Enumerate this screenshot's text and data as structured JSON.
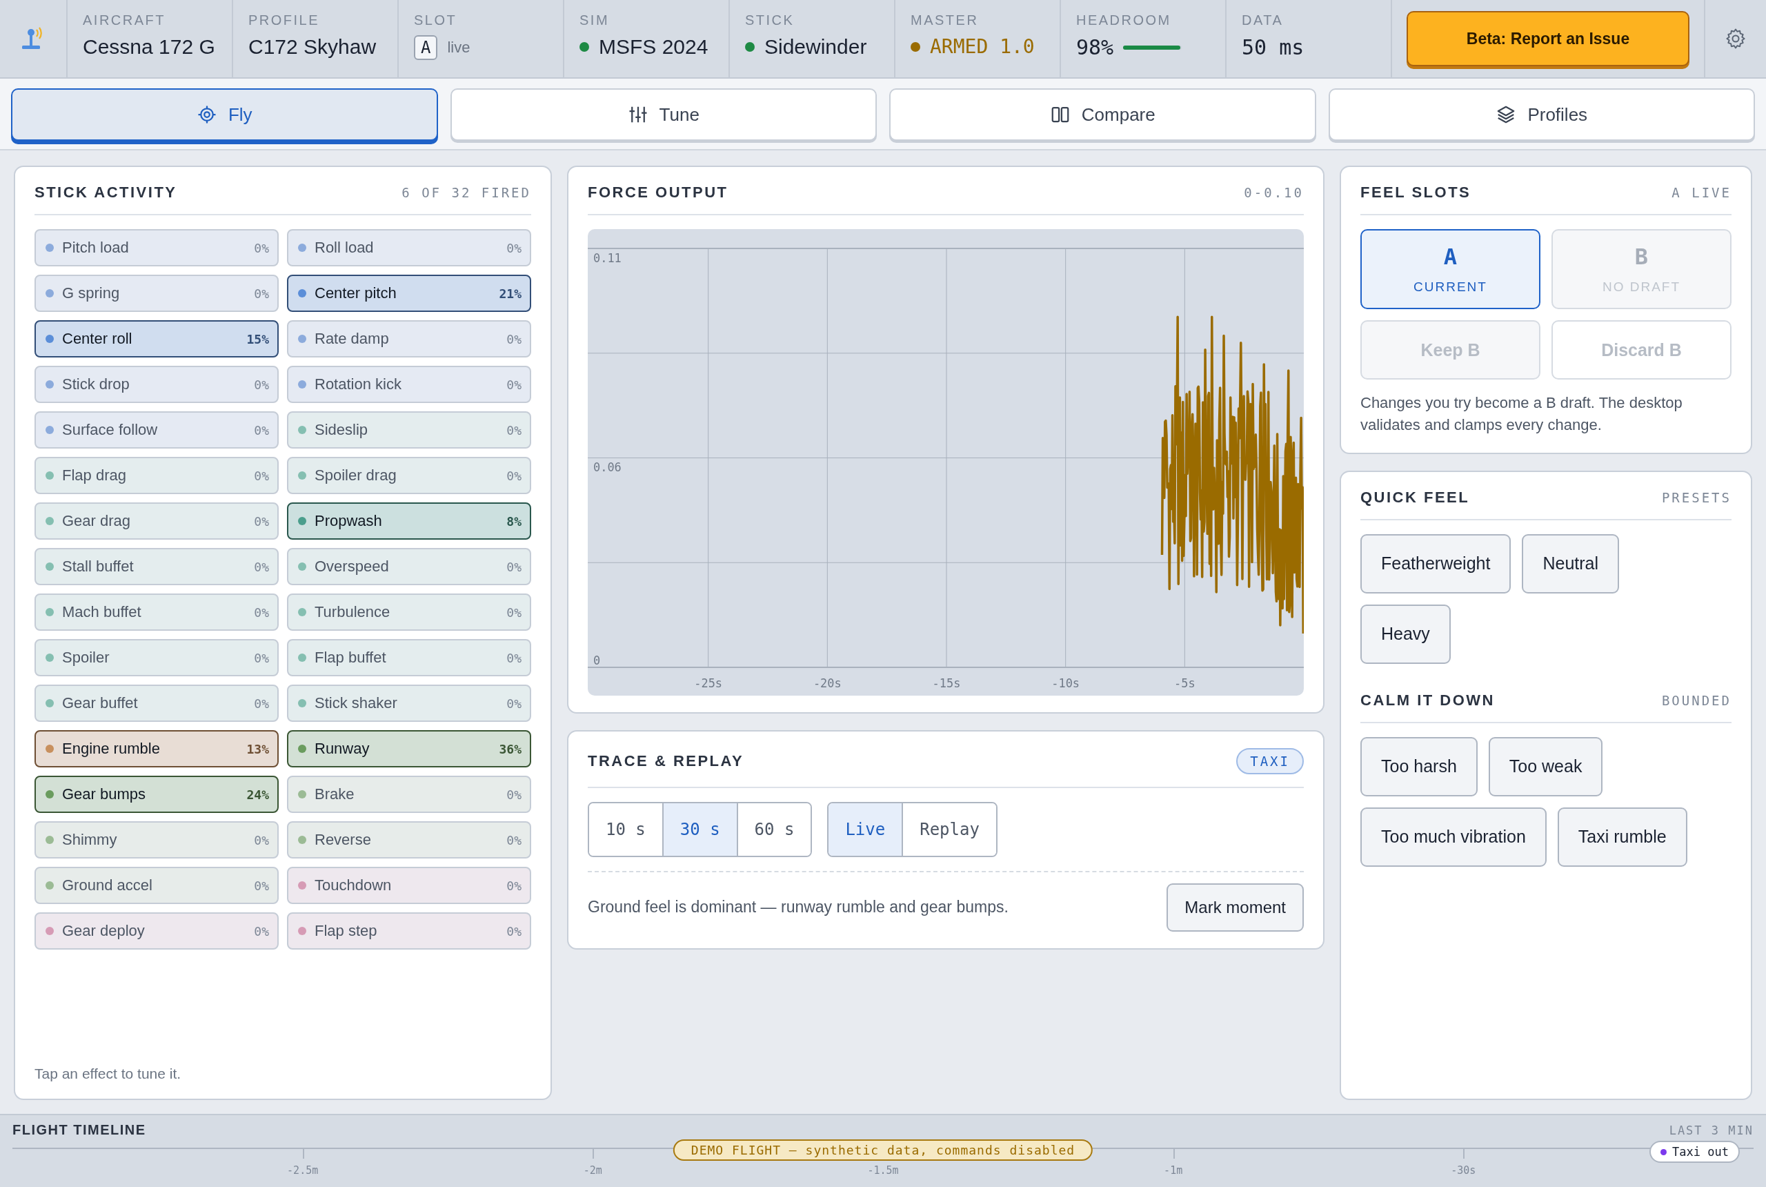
{
  "header": {
    "fields": [
      {
        "kind": "text",
        "label": "AIRCRAFT",
        "value": "Cessna 172 G"
      },
      {
        "kind": "text",
        "label": "PROFILE",
        "value": "C172 Skyhaw"
      },
      {
        "kind": "slot",
        "label": "SLOT",
        "badge": "A",
        "value": "live"
      },
      {
        "kind": "status",
        "label": "SIM",
        "value": "MSFS 2024",
        "color": "#1e8a44"
      },
      {
        "kind": "status",
        "label": "STICK",
        "value": "Sidewinder",
        "color": "#1e8a44"
      },
      {
        "kind": "alert",
        "label": "MASTER",
        "value": "ARMED 1.0",
        "color": "#9a6b00"
      },
      {
        "kind": "meter",
        "label": "HEADROOM",
        "value": "98%",
        "level": 0.98
      },
      {
        "kind": "mono",
        "label": "DATA",
        "value": "50 ms"
      }
    ],
    "report_button": "Beta: Report an Issue"
  },
  "tabs": [
    {
      "label": "Fly",
      "selected": true
    },
    {
      "label": "Tune",
      "selected": false
    },
    {
      "label": "Compare",
      "selected": false
    },
    {
      "label": "Profiles",
      "selected": false
    }
  ],
  "stick_activity": {
    "title": "STICK ACTIVITY",
    "summary": "6 OF 32 FIRED",
    "effects": [
      {
        "label": "Pitch load",
        "value": "0%",
        "color": "#8cabdc",
        "active": false
      },
      {
        "label": "Roll load",
        "value": "0%",
        "color": "#8cabdc",
        "active": false
      },
      {
        "label": "G spring",
        "value": "0%",
        "color": "#8cabdc",
        "active": false
      },
      {
        "label": "Center pitch",
        "value": "21%",
        "color": "#5b8ed8",
        "active": true
      },
      {
        "label": "Center roll",
        "value": "15%",
        "color": "#5b8ed8",
        "active": true
      },
      {
        "label": "Rate damp",
        "value": "0%",
        "color": "#8cabdc",
        "active": false
      },
      {
        "label": "Stick drop",
        "value": "0%",
        "color": "#8cabdc",
        "active": false
      },
      {
        "label": "Rotation kick",
        "value": "0%",
        "color": "#8cabdc",
        "active": false
      },
      {
        "label": "Surface follow",
        "value": "0%",
        "color": "#8cabdc",
        "active": false
      },
      {
        "label": "Sideslip",
        "value": "0%",
        "color": "#85bfb1",
        "active": false
      },
      {
        "label": "Flap drag",
        "value": "0%",
        "color": "#85bfb1",
        "active": false
      },
      {
        "label": "Spoiler drag",
        "value": "0%",
        "color": "#85bfb1",
        "active": false
      },
      {
        "label": "Gear drag",
        "value": "0%",
        "color": "#85bfb1",
        "active": false
      },
      {
        "label": "Propwash",
        "value": "8%",
        "color": "#4a9e8c",
        "active": true
      },
      {
        "label": "Stall buffet",
        "value": "0%",
        "color": "#85bfb1",
        "active": false
      },
      {
        "label": "Overspeed",
        "value": "0%",
        "color": "#85bfb1",
        "active": false
      },
      {
        "label": "Mach buffet",
        "value": "0%",
        "color": "#85bfb1",
        "active": false
      },
      {
        "label": "Turbulence",
        "value": "0%",
        "color": "#85bfb1",
        "active": false
      },
      {
        "label": "Spoiler",
        "value": "0%",
        "color": "#85bfb1",
        "active": false
      },
      {
        "label": "Flap buffet",
        "value": "0%",
        "color": "#85bfb1",
        "active": false
      },
      {
        "label": "Gear buffet",
        "value": "0%",
        "color": "#85bfb1",
        "active": false
      },
      {
        "label": "Stick shaker",
        "value": "0%",
        "color": "#85bfb1",
        "active": false
      },
      {
        "label": "Engine rumble",
        "value": "13%",
        "color": "#c8905e",
        "active": true
      },
      {
        "label": "Runway",
        "value": "36%",
        "color": "#6a9c5e",
        "active": true
      },
      {
        "label": "Gear bumps",
        "value": "24%",
        "color": "#6a9c5e",
        "active": true
      },
      {
        "label": "Brake",
        "value": "0%",
        "color": "#9bbb95",
        "active": false
      },
      {
        "label": "Shimmy",
        "value": "0%",
        "color": "#9bbb95",
        "active": false
      },
      {
        "label": "Reverse",
        "value": "0%",
        "color": "#9bbb95",
        "active": false
      },
      {
        "label": "Ground accel",
        "value": "0%",
        "color": "#9bbb95",
        "active": false
      },
      {
        "label": "Touchdown",
        "value": "0%",
        "color": "#d69bb5",
        "active": false
      },
      {
        "label": "Gear deploy",
        "value": "0%",
        "color": "#d69bb5",
        "active": false
      },
      {
        "label": "Flap step",
        "value": "0%",
        "color": "#d69bb5",
        "active": false
      }
    ],
    "hint": "Tap an effect to tune it."
  },
  "force_output": {
    "title": "FORCE OUTPUT",
    "range": "0-0.10",
    "y_labels": [
      "0.11",
      "0.06",
      "0"
    ],
    "x_labels": [
      "-25s",
      "-20s",
      "-15s",
      "-10s",
      "-5s"
    ]
  },
  "trace_replay": {
    "title": "TRACE & REPLAY",
    "badge": "TAXI",
    "windows": [
      {
        "label": "10 s",
        "selected": false
      },
      {
        "label": "30 s",
        "selected": true
      },
      {
        "label": "60 s",
        "selected": false
      }
    ],
    "modes": [
      {
        "label": "Live",
        "selected": true
      },
      {
        "label": "Replay",
        "selected": false
      }
    ],
    "note": "Ground feel is dominant — runway rumble and gear bumps.",
    "action": "Mark moment"
  },
  "feel_slots": {
    "title": "FEEL SLOTS",
    "status": "A LIVE",
    "slots": [
      {
        "letter": "A",
        "caption": "CURRENT",
        "selected": true,
        "disabled": false
      },
      {
        "letter": "B",
        "caption": "NO DRAFT",
        "selected": false,
        "disabled": true
      }
    ],
    "actions": [
      {
        "label": "Keep B",
        "disabled": true
      },
      {
        "label": "Discard B",
        "disabled": true
      }
    ],
    "note": "Changes you try become a B draft. The desktop validates and clamps every change."
  },
  "quick_feel": {
    "title": "QUICK FEEL",
    "tag": "PRESETS",
    "presets": [
      "Featherweight",
      "Neutral",
      "Heavy"
    ]
  },
  "calm_it_down": {
    "title": "CALM IT DOWN",
    "tag": "BOUNDED",
    "fixes": [
      "Too harsh",
      "Too weak",
      "Too much vibration",
      "Taxi rumble"
    ]
  },
  "timeline": {
    "title": "FLIGHT TIMELINE",
    "span": "LAST 3 MIN",
    "ticks": [
      "-2.5m",
      "-2m",
      "-1.5m",
      "-1m",
      "-30s"
    ],
    "banner": "DEMO FLIGHT — synthetic data, commands disabled",
    "events": [
      {
        "label": "Taxi out",
        "color": "#7c3aed"
      }
    ]
  }
}
